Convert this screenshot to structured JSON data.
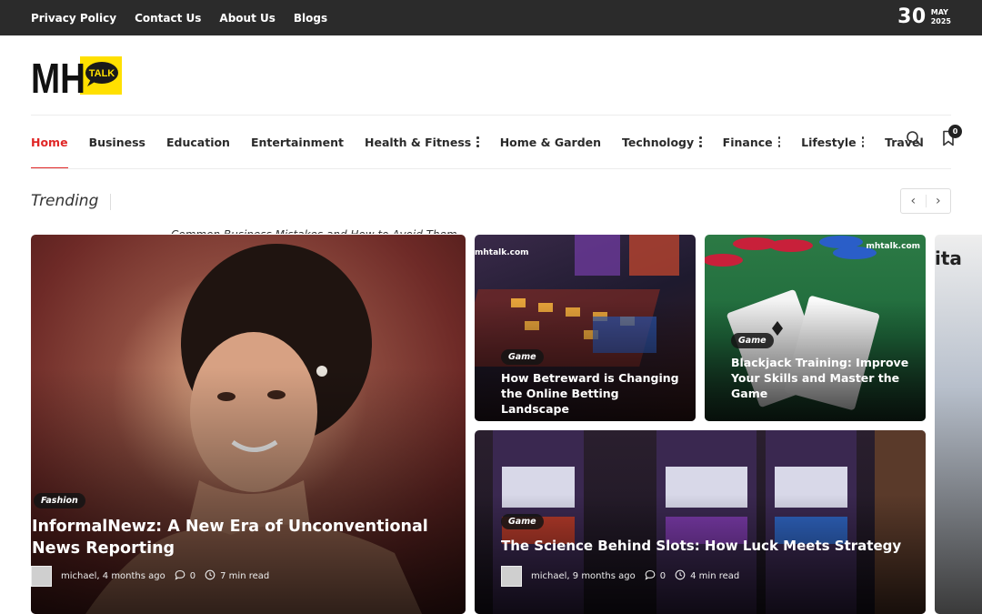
{
  "topbar": {
    "links": [
      "Privacy Policy",
      "Contact Us",
      "About Us",
      "Blogs"
    ],
    "date_day": "30",
    "date_month": "MAY",
    "date_year": "2025"
  },
  "logo": {
    "letters": "MH",
    "bubble": "TALK"
  },
  "nav": {
    "items": [
      {
        "label": "Home",
        "active": true,
        "has_sub": false
      },
      {
        "label": "Business",
        "has_sub": false
      },
      {
        "label": "Education",
        "has_sub": false
      },
      {
        "label": "Entertainment",
        "has_sub": false
      },
      {
        "label": "Health & Fitness",
        "has_sub": true
      },
      {
        "label": "Home & Garden",
        "has_sub": false
      },
      {
        "label": "Technology",
        "has_sub": true
      },
      {
        "label": "Finance",
        "has_sub": true
      },
      {
        "label": "Lifestyle",
        "has_sub": true
      },
      {
        "label": "Travel",
        "has_sub": false
      }
    ],
    "bookmark_count": "0"
  },
  "trending": {
    "label": "Trending",
    "ticker": "Common Business Mistakes and How to Avoid Them",
    "prev_icon": "chevron-left-icon",
    "next_icon": "chevron-right-icon"
  },
  "cards": {
    "main": {
      "category": "Fashion",
      "title": "InformalNewz: A New Era of Unconventional News Reporting",
      "author_time": "michael, 4 months ago",
      "comments": "0",
      "read_time": "7 min read"
    },
    "top_left": {
      "watermark": "mhtalk.com",
      "category": "Game",
      "title": "How Betreward is Changing the Online Betting Landscape"
    },
    "top_right": {
      "watermark": "mhtalk.com",
      "category": "Game",
      "title": "Blackjack Training: Improve Your Skills and Master the Game"
    },
    "bottom": {
      "category": "Game",
      "title": "The Science Behind Slots: How Luck Meets Strategy",
      "author_time": "michael, 9 months ago",
      "comments": "0",
      "read_time": "4 min read"
    },
    "edge_text": "ita"
  },
  "colors": {
    "accent": "#e02626",
    "topbar": "#2b2b2b",
    "logo_yellow": "#ffe000"
  }
}
